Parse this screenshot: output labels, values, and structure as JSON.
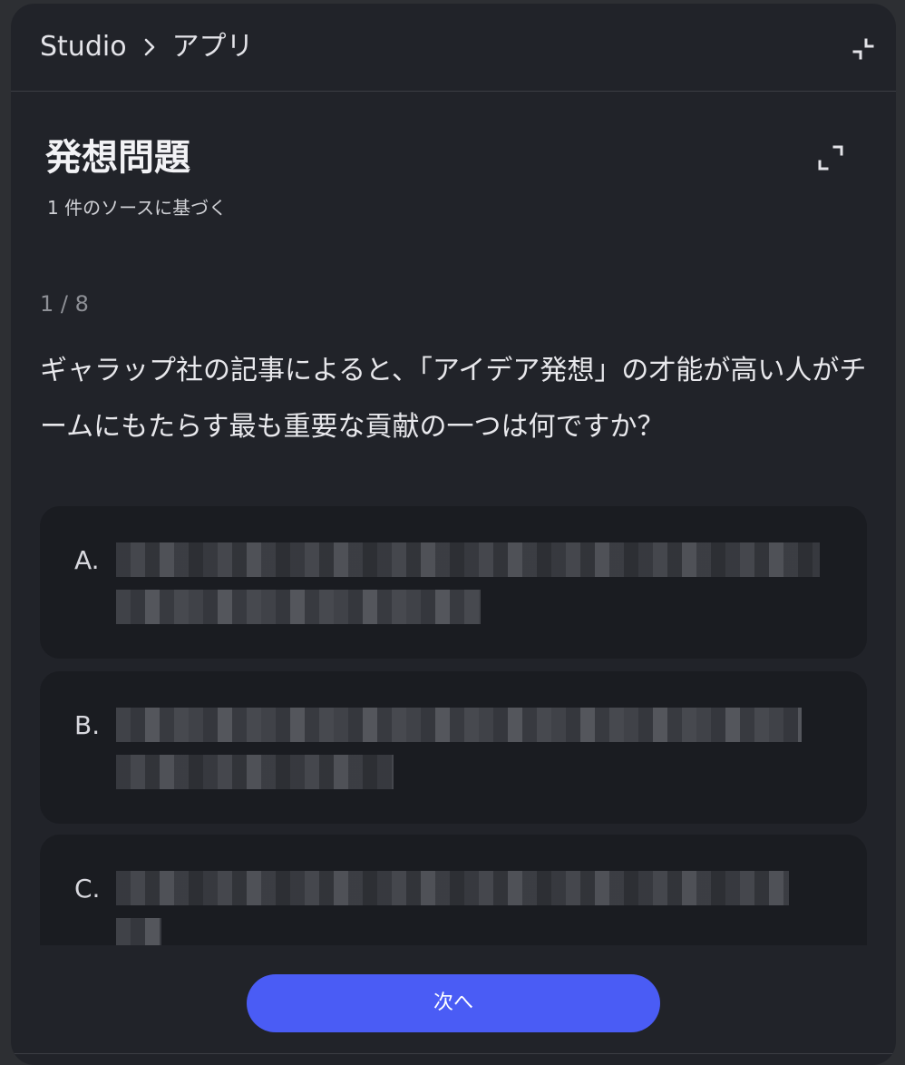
{
  "header": {
    "breadcrumb_root": "Studio",
    "breadcrumb_current": "アプリ",
    "separator_icon": "chevron-right-icon",
    "collapse_icon": "collapse-icon"
  },
  "quiz": {
    "title": "発想問題",
    "source_info": "1 件のソースに基づく",
    "expand_icon": "expand-icon",
    "counter": "1 / 8",
    "question": "ギャラップ社の記事によると、「アイデア発想」の才能が高い人がチームにもたらす最も重要な貢献の一つは何ですか？",
    "options": [
      {
        "letter": "A."
      },
      {
        "letter": "B."
      },
      {
        "letter": "C."
      }
    ],
    "next_label": "次へ"
  },
  "colors": {
    "background": "#212329",
    "option_background": "#1a1c21",
    "accent": "#4a5cf5"
  }
}
